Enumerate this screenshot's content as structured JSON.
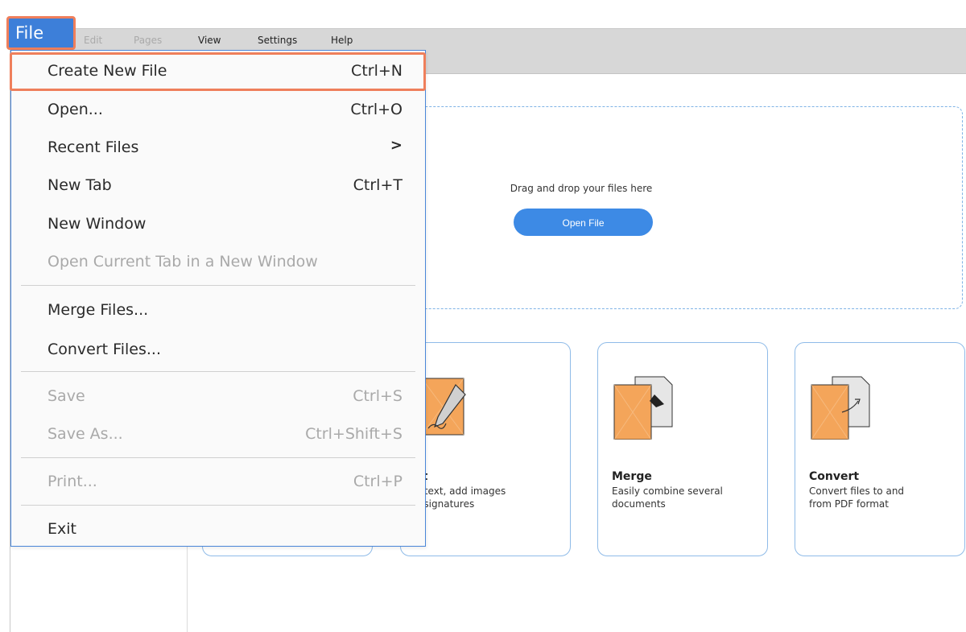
{
  "menubar": {
    "file": "File",
    "edit": "Edit",
    "pages": "Pages",
    "view": "View",
    "settings": "Settings",
    "help": "Help"
  },
  "file_menu": {
    "items": [
      {
        "label": "Create New File",
        "shortcut": "Ctrl+N",
        "enabled": true,
        "highlighted": true
      },
      {
        "label": "Open...",
        "shortcut": "Ctrl+O",
        "enabled": true
      },
      {
        "label": "Recent Files",
        "shortcut": ">",
        "enabled": true
      },
      {
        "label": "New Tab",
        "shortcut": "Ctrl+T",
        "enabled": true
      },
      {
        "label": "New Window",
        "shortcut": "",
        "enabled": true
      },
      {
        "label": "Open Current Tab in a New Window",
        "shortcut": "",
        "enabled": false
      },
      {
        "label": "Merge Files...",
        "shortcut": "",
        "enabled": true
      },
      {
        "label": "Convert Files...",
        "shortcut": "",
        "enabled": true
      },
      {
        "label": "Save",
        "shortcut": "Ctrl+S",
        "enabled": false
      },
      {
        "label": "Save As...",
        "shortcut": "Ctrl+Shift+S",
        "enabled": false
      },
      {
        "label": "Print...",
        "shortcut": "Ctrl+P",
        "enabled": false
      },
      {
        "label": "Exit",
        "shortcut": "",
        "enabled": true
      }
    ]
  },
  "dropzone": {
    "text": "Drag and drop your files here",
    "button": "Open File"
  },
  "cards": [
    {
      "title": "lit",
      "desc_line1": "it text, add images",
      "desc_line2": "d signatures"
    },
    {
      "title": "Merge",
      "desc_line1": "Easily combine several",
      "desc_line2": "documents"
    },
    {
      "title": "Convert",
      "desc_line1": "Convert files to and",
      "desc_line2": "from PDF format"
    }
  ],
  "colors": {
    "accent": "#3d8ae5",
    "highlight_outline": "#ef7f5b",
    "card_border": "#8fbbe8",
    "icon_orange": "#f4a55a"
  }
}
